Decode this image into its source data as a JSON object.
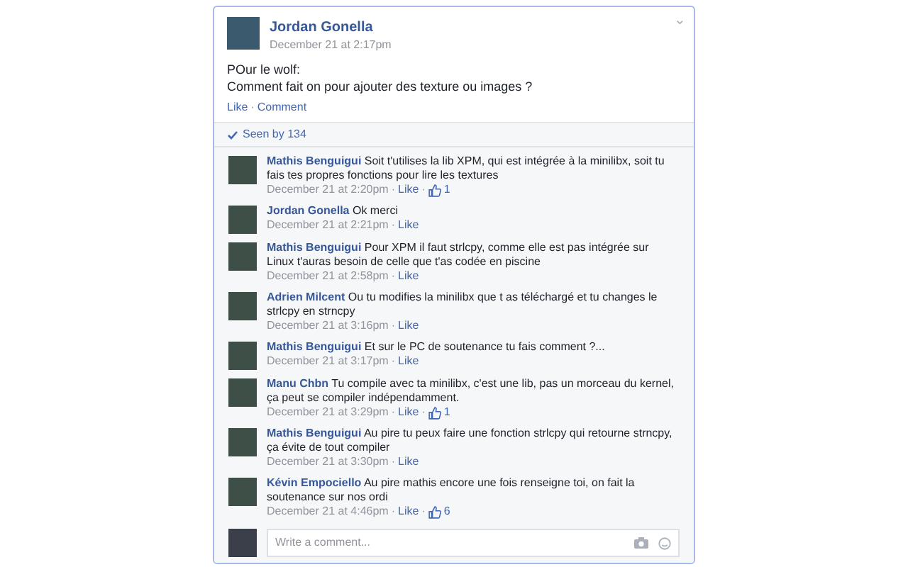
{
  "post": {
    "author": "Jordan Gonella",
    "time": "December 21 at 2:17pm",
    "lines": [
      "POur le wolf:",
      "Comment fait on pour ajouter des texture ou images ?"
    ],
    "actions": [
      "Like",
      "Comment"
    ],
    "separator": "·",
    "menu_caret": "⌄"
  },
  "seen": {
    "label": "Seen by 134"
  },
  "comments": [
    {
      "author": "Mathis Benguigui",
      "text": "Soit t'utilises la lib XPM, qui est intégrée à la minilibx, soit tu fais tes propres fonctions pour lire les textures",
      "time": "December 21 at 2:20pm",
      "like": "Like",
      "likes": "1"
    },
    {
      "author": "Jordan Gonella",
      "text": "Ok merci",
      "time": "December 21 at 2:21pm",
      "like": "Like"
    },
    {
      "author": "Mathis Benguigui",
      "text": "Pour XPM il faut strlcpy, comme elle est pas intégrée sur Linux t'auras besoin de celle que t'as codée en piscine",
      "time": "December 21 at 2:58pm",
      "like": "Like"
    },
    {
      "author": "Adrien Milcent",
      "text": "Ou tu modifies la minilibx que t as téléchargé et tu changes le strlcpy en strncpy",
      "time": "December 21 at 3:16pm",
      "like": "Like"
    },
    {
      "author": "Mathis Benguigui",
      "text": "Et sur le PC de soutenance tu fais comment ?...",
      "time": "December 21 at 3:17pm",
      "like": "Like"
    },
    {
      "author": "Manu Chbn",
      "text": "Tu compile avec ta minilibx, c'est une lib, pas un morceau du kernel, ça peut se compiler indépendamment.",
      "time": "December 21 at 3:29pm",
      "like": "Like",
      "likes": "1"
    },
    {
      "author": "Mathis Benguigui",
      "text": "Au pire tu peux faire une fonction strlcpy qui retourne strncpy, ça évite de tout compiler",
      "time": "December 21 at 3:30pm",
      "like": "Like"
    },
    {
      "author": "Kévin Empociello",
      "text": "Au pire mathis encore une fois renseigne toi, on fait la soutenance sur nos ordi",
      "time": "December 21 at 4:46pm",
      "like": "Like",
      "likes": "6"
    }
  ],
  "composer": {
    "placeholder": "Write a comment..."
  }
}
